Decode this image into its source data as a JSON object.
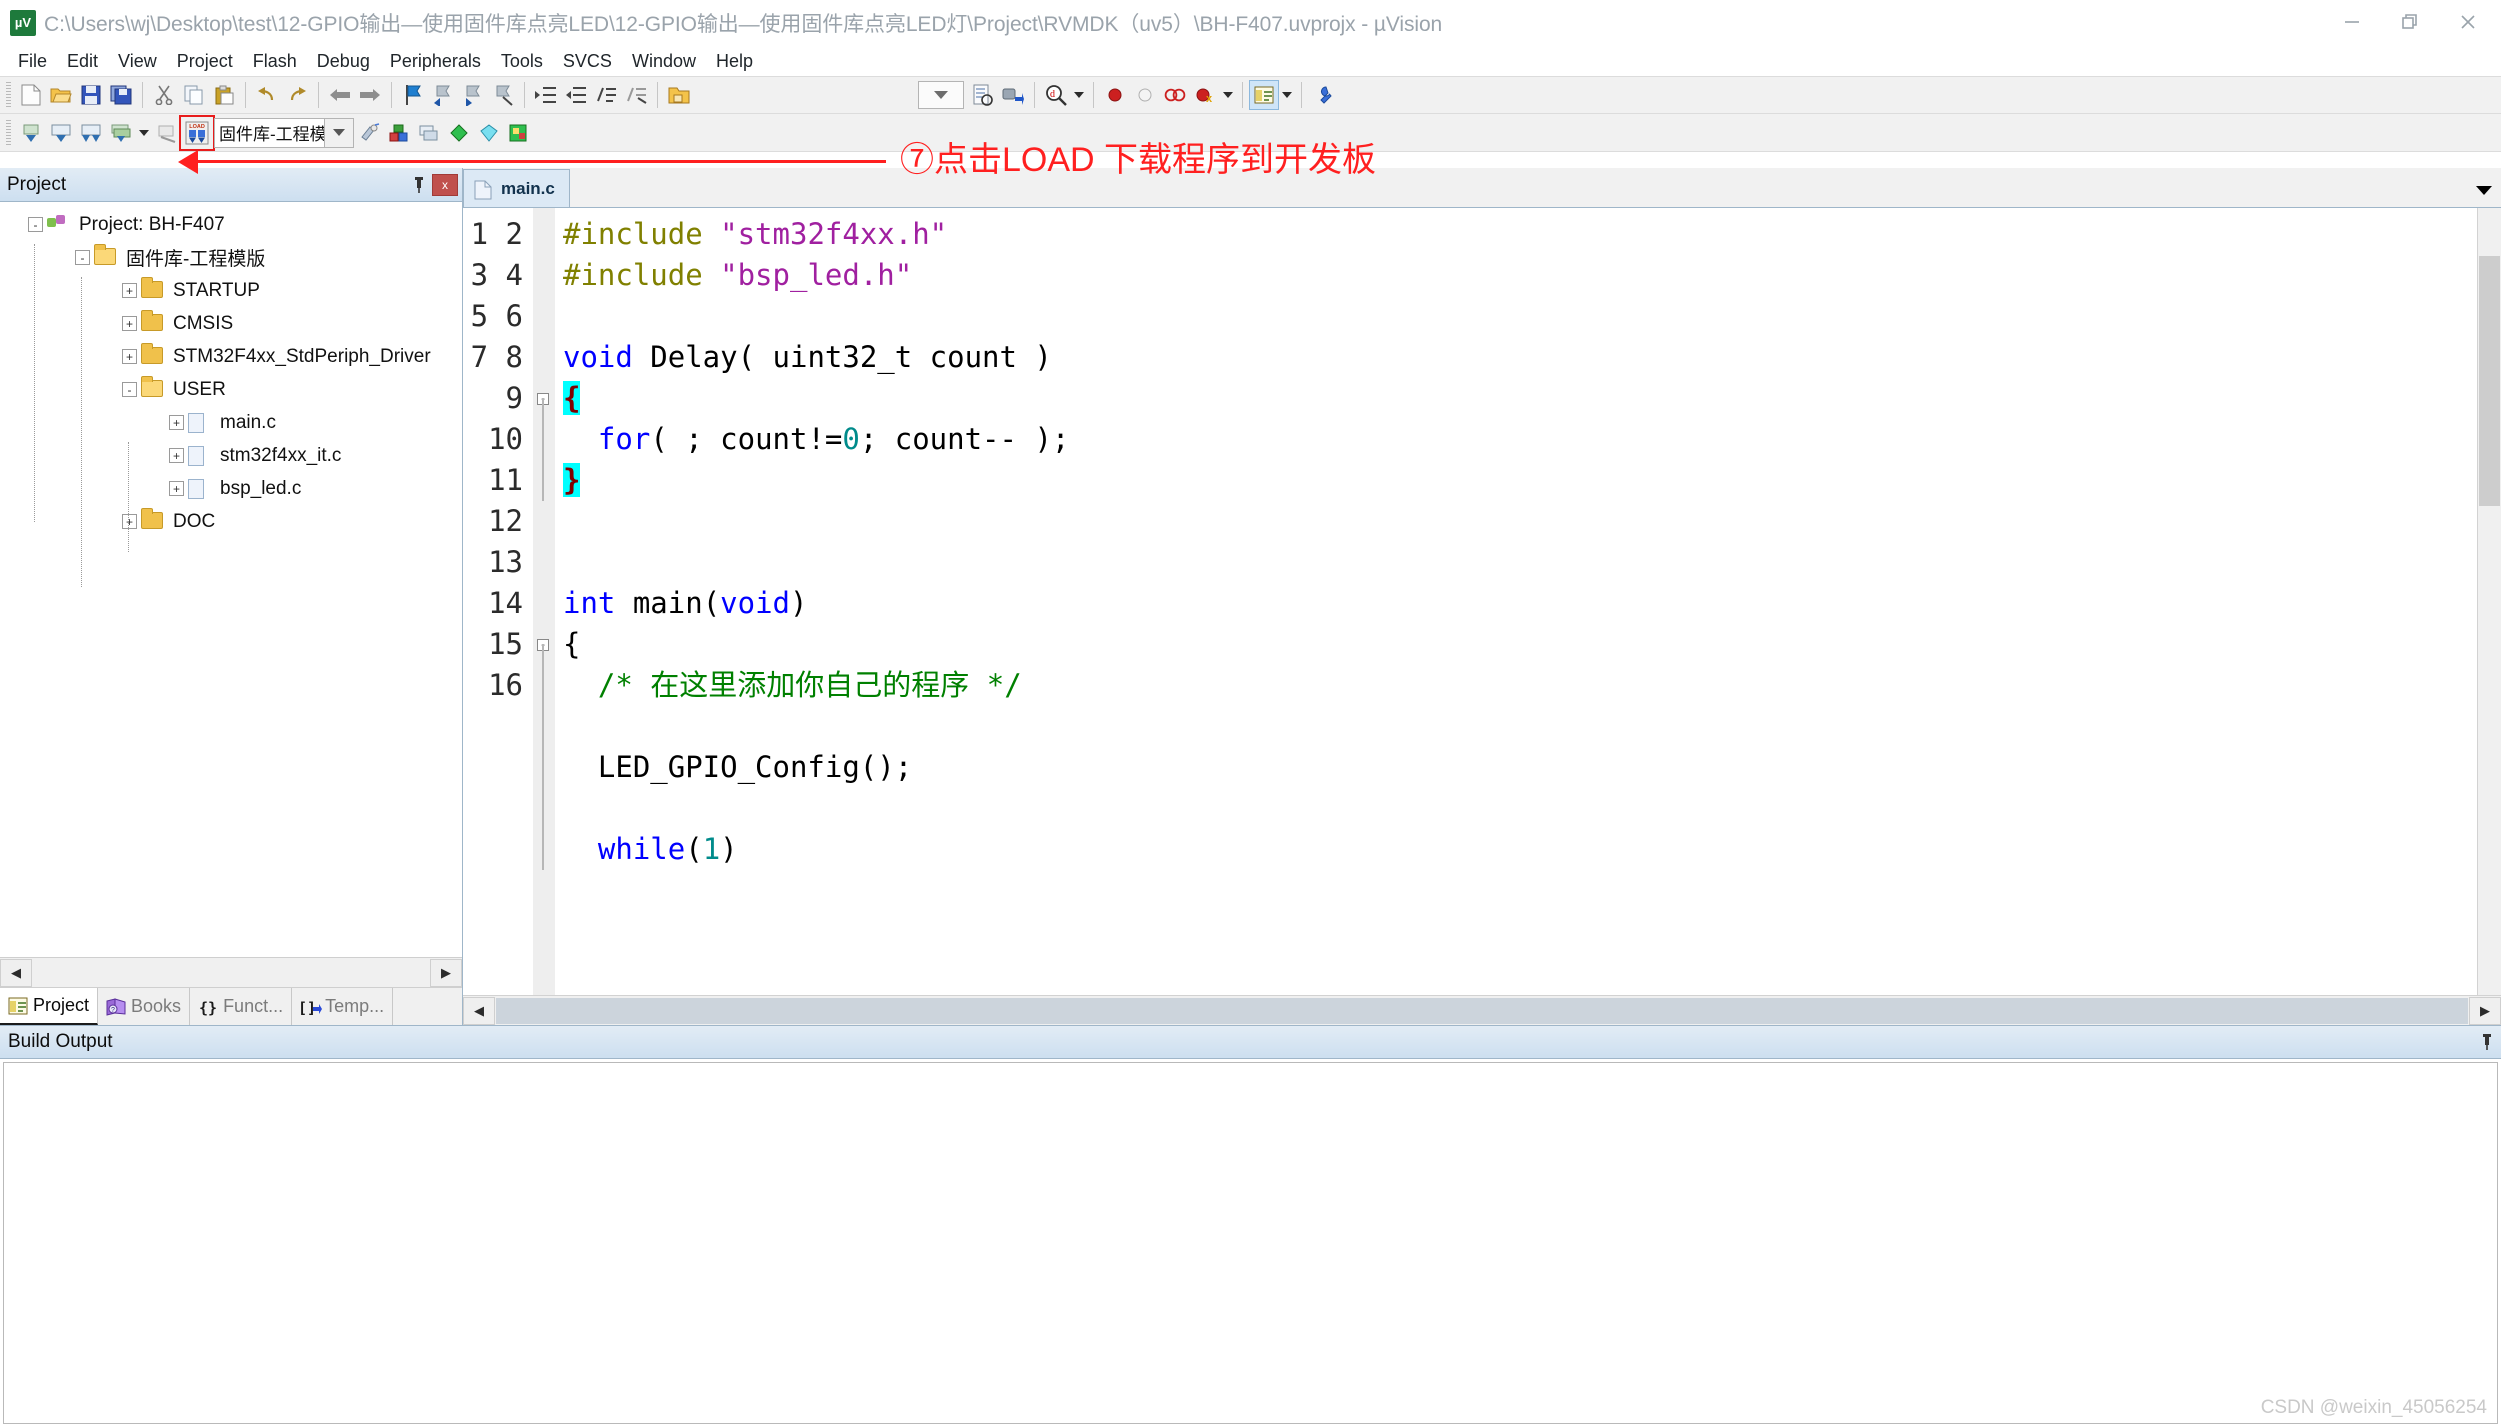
{
  "window": {
    "title": "C:\\Users\\wj\\Desktop\\test\\12-GPIO输出—使用固件库点亮LED\\12-GPIO输出—使用固件库点亮LED灯\\Project\\RVMDK（uv5）\\BH-F407.uvprojx - µVision",
    "app_icon_label": "µV",
    "minimize": "—",
    "restore": "❐",
    "close": "✕"
  },
  "menubar": {
    "items": [
      {
        "label": "File"
      },
      {
        "label": "Edit"
      },
      {
        "label": "View"
      },
      {
        "label": "Project"
      },
      {
        "label": "Flash"
      },
      {
        "label": "Debug"
      },
      {
        "label": "Peripherals"
      },
      {
        "label": "Tools"
      },
      {
        "label": "SVCS"
      },
      {
        "label": "Window"
      },
      {
        "label": "Help"
      }
    ]
  },
  "toolbar_main": {
    "icons": [
      "new-file-icon",
      "open-file-icon",
      "save-icon",
      "save-all-icon",
      "cut-icon",
      "copy-icon",
      "paste-icon",
      "undo-icon",
      "redo-icon",
      "navigate-back-icon",
      "navigate-forward-icon",
      "bookmark-toggle-icon",
      "bookmark-prev-icon",
      "bookmark-next-icon",
      "bookmark-clear-icon",
      "indent-icon",
      "outdent-icon",
      "comment-icon",
      "uncomment-icon",
      "open-folder-icon"
    ],
    "combo_caret": "chevron-down-icon",
    "right_icons": [
      "configure-target-icon",
      "debug-session-icon",
      "find-in-files-icon",
      "breakpoint-insert-icon",
      "breakpoint-disable-icon",
      "breakpoint-kill-all-icon",
      "breakpoint-disable-all-icon",
      "window-manager-icon",
      "configuration-wizard-icon"
    ]
  },
  "toolbar_build": {
    "icons": [
      "translate-file-icon",
      "build-target-icon",
      "rebuild-all-icon",
      "batch-build-icon"
    ],
    "stop-build-icon": "stop-build-icon",
    "load_button": {
      "name": "load-button",
      "label": "LOAD",
      "highlighted": true,
      "highlight_color": "#e81c1c"
    },
    "target_select": {
      "value": "固件库-工程模版",
      "display": "固件库-工…"
    },
    "right_icons": [
      "target-options-icon",
      "manage-project-items-icon",
      "manage-layers-icon",
      "multi-project-icon",
      "pack-installer-icon",
      "manage-run-time-env-icon"
    ]
  },
  "annotation": {
    "text": "⑦点击LOAD 下载程序到开发板",
    "color": "#ff2020"
  },
  "project_panel": {
    "title": "Project",
    "pin_icon": "pin-icon",
    "close_icon": "close-icon",
    "tree": [
      {
        "depth": 0,
        "label": "Project: BH-F407",
        "icon": "project-icon",
        "expander": "-"
      },
      {
        "depth": 1,
        "label": "固件库-工程模版",
        "icon": "folder-open-icon",
        "expander": "-"
      },
      {
        "depth": 2,
        "label": "STARTUP",
        "icon": "folder-icon",
        "expander": "+"
      },
      {
        "depth": 2,
        "label": "CMSIS",
        "icon": "folder-icon",
        "expander": "+"
      },
      {
        "depth": 2,
        "label": "STM32F4xx_StdPeriph_Driver",
        "icon": "folder-icon",
        "expander": "+"
      },
      {
        "depth": 2,
        "label": "USER",
        "icon": "folder-open-icon",
        "expander": "-"
      },
      {
        "depth": 3,
        "label": "main.c",
        "icon": "c-file-icon",
        "expander": "+"
      },
      {
        "depth": 3,
        "label": "stm32f4xx_it.c",
        "icon": "c-file-icon",
        "expander": "+"
      },
      {
        "depth": 3,
        "label": "bsp_led.c",
        "icon": "c-file-icon",
        "expander": "+"
      },
      {
        "depth": 2,
        "label": "DOC",
        "icon": "folder-icon",
        "expander": "+"
      }
    ],
    "scroll_left": "◀",
    "scroll_right": "▶",
    "tabs": [
      {
        "label": "Project",
        "icon": "project-tab-icon",
        "active": true
      },
      {
        "label": "Books",
        "icon": "books-tab-icon",
        "active": false
      },
      {
        "label": "Funct...",
        "icon": "functions-tab-icon",
        "active": false
      },
      {
        "label": "Temp...",
        "icon": "templates-tab-icon",
        "active": false
      }
    ]
  },
  "editor": {
    "tab": {
      "label": "main.c",
      "icon": "c-file-icon"
    },
    "tabstrip_scroll": "chevron-down-icon",
    "hscroll_left": "◀",
    "hscroll_right": "▶",
    "lines": [
      {
        "n": 1,
        "tokens": [
          {
            "t": "#include ",
            "c": "pp"
          },
          {
            "t": "\"stm32f4xx.h\"",
            "c": "str"
          }
        ]
      },
      {
        "n": 2,
        "tokens": [
          {
            "t": "#include ",
            "c": "pp"
          },
          {
            "t": "\"bsp_led.h\"",
            "c": "str"
          }
        ]
      },
      {
        "n": 3,
        "tokens": []
      },
      {
        "n": 4,
        "tokens": [
          {
            "t": "void",
            "c": "k"
          },
          {
            "t": " Delay( uint32_t count )",
            "c": ""
          }
        ]
      },
      {
        "n": 5,
        "tokens": [
          {
            "t": "{",
            "c": "brace"
          }
        ],
        "fold": "start"
      },
      {
        "n": 6,
        "tokens": [
          {
            "t": "  ",
            "c": ""
          },
          {
            "t": "for",
            "c": "k"
          },
          {
            "t": "( ; count!=",
            "c": ""
          },
          {
            "t": "0",
            "c": "num"
          },
          {
            "t": "; count-- );",
            "c": ""
          }
        ],
        "fold": "bar"
      },
      {
        "n": 7,
        "tokens": [
          {
            "t": "}",
            "c": "brace"
          }
        ],
        "fold": "end"
      },
      {
        "n": 8,
        "tokens": []
      },
      {
        "n": 9,
        "tokens": []
      },
      {
        "n": 10,
        "tokens": [
          {
            "t": "int",
            "c": "k"
          },
          {
            "t": " main(",
            "c": ""
          },
          {
            "t": "void",
            "c": "k"
          },
          {
            "t": ")",
            "c": ""
          }
        ]
      },
      {
        "n": 11,
        "tokens": [
          {
            "t": "{",
            "c": ""
          }
        ],
        "fold": "start"
      },
      {
        "n": 12,
        "tokens": [
          {
            "t": "  ",
            "c": ""
          },
          {
            "t": "/* 在这里添加你自己的程序 */",
            "c": "cmt"
          }
        ],
        "fold": "bar"
      },
      {
        "n": 13,
        "tokens": [],
        "fold": "bar"
      },
      {
        "n": 14,
        "tokens": [
          {
            "t": "  LED_GPIO_Config();",
            "c": ""
          }
        ],
        "fold": "bar"
      },
      {
        "n": 15,
        "tokens": [],
        "fold": "bar"
      },
      {
        "n": 16,
        "tokens": [
          {
            "t": "  ",
            "c": ""
          },
          {
            "t": "while",
            "c": "k"
          },
          {
            "t": "(",
            "c": ""
          },
          {
            "t": "1",
            "c": "num"
          },
          {
            "t": ")",
            "c": ""
          }
        ],
        "fold": "bar"
      }
    ]
  },
  "build_output": {
    "title": "Build Output",
    "pin_icon": "pin-icon",
    "content": ""
  },
  "watermark": {
    "text": "CSDN @weixin_45056254"
  }
}
